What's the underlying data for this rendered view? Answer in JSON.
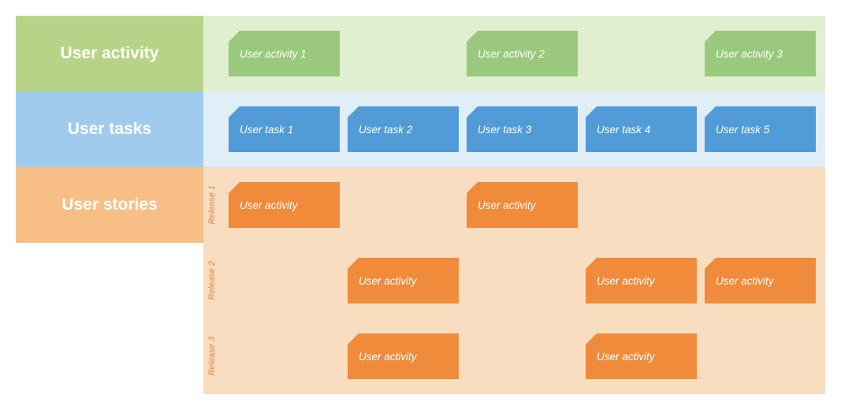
{
  "labels": {
    "activity": "User activity",
    "tasks": "User tasks",
    "stories": "User stories"
  },
  "activities": [
    "User activity 1",
    "User activity 2",
    "User activity 3"
  ],
  "tasks": [
    "User task 1",
    "User task 2",
    "User task 3",
    "User task 4",
    "User task 5"
  ],
  "releases": [
    {
      "label": "Release 1",
      "stories": [
        {
          "col": 1,
          "text": "User activity"
        },
        {
          "col": 3,
          "text": "User activity"
        }
      ]
    },
    {
      "label": "Release 2",
      "stories": [
        {
          "col": 2,
          "text": "User activity"
        },
        {
          "col": 4,
          "text": "User activity"
        },
        {
          "col": 5,
          "text": "User activity"
        }
      ]
    },
    {
      "label": "Release 3",
      "stories": [
        {
          "col": 2,
          "text": "User activity"
        },
        {
          "col": 4,
          "text": "User activity"
        }
      ]
    }
  ]
}
